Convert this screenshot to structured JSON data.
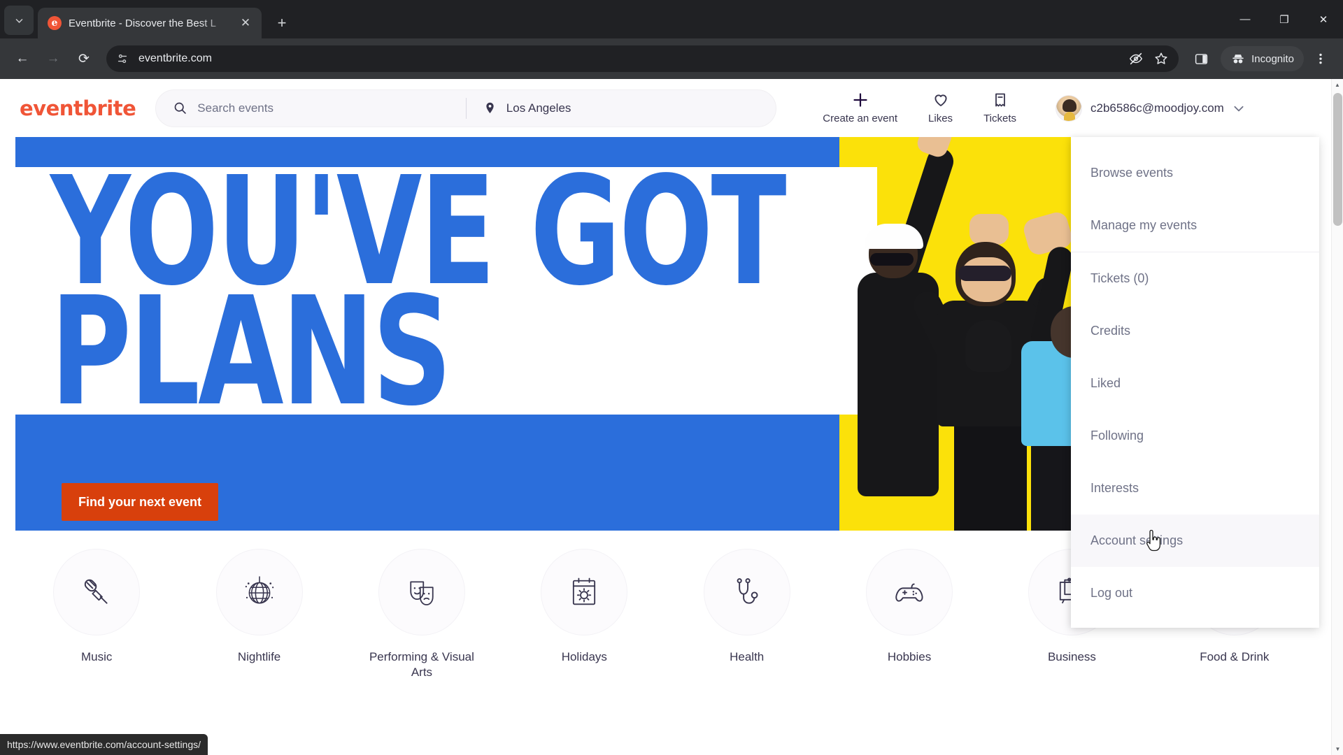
{
  "browser": {
    "tab": {
      "title": "Eventbrite - Discover the Best L",
      "favicon_letter": "e",
      "close_label": "✕",
      "search_tabs_icon": "chevron-down-icon"
    },
    "new_tab_label": "+",
    "window_controls": {
      "minimize": "—",
      "maximize": "❐",
      "close": "✕"
    },
    "nav": {
      "back": "←",
      "forward": "→",
      "reload": "⟳"
    },
    "omnibox": {
      "url": "eventbrite.com",
      "site_info_icon": "tune-icon"
    },
    "toolbar_right": {
      "hide_icon": "eye-slash-icon",
      "bookmark_icon": "star-icon",
      "sidepanel_icon": "side-panel-icon",
      "incognito_label": "Incognito",
      "menu_icon": "kebab-menu-icon"
    }
  },
  "status_bar": {
    "url": "https://www.eventbrite.com/account-settings/"
  },
  "site": {
    "logo": "eventbrite",
    "search": {
      "events_placeholder": "Search events",
      "location_value": "Los Angeles",
      "search_icon": "magnifier-icon",
      "location_icon": "map-pin-icon"
    },
    "nav": [
      {
        "label": "Create an event",
        "icon": "plus-icon"
      },
      {
        "label": "Likes",
        "icon": "heart-icon"
      },
      {
        "label": "Tickets",
        "icon": "ticket-icon"
      }
    ],
    "account": {
      "email": "c2b6586c@moodjoy.com",
      "avatar_icon": "user-avatar",
      "chevron_icon": "chevron-down-icon"
    },
    "dropdown": {
      "items": [
        {
          "label": "Browse events",
          "hover": false
        },
        {
          "label": "Manage my events",
          "hover": false
        },
        {
          "label": "Tickets (0)",
          "hover": false
        },
        {
          "label": "Credits",
          "hover": false
        },
        {
          "label": "Liked",
          "hover": false
        },
        {
          "label": "Following",
          "hover": false
        },
        {
          "label": "Interests",
          "hover": false
        },
        {
          "label": "Account settings",
          "hover": true
        },
        {
          "label": "Log out",
          "hover": false
        }
      ]
    },
    "hero": {
      "headline_line1": "YOU'VE GOT",
      "headline_line2": "PLANS",
      "cta_label": "Find your next event",
      "bg_blue": "#2b6edb",
      "bg_yellow": "#fbe10a",
      "cta_color": "#d8400c"
    },
    "categories": [
      {
        "label": "Music",
        "icon": "microphone-icon"
      },
      {
        "label": "Nightlife",
        "icon": "disco-ball-icon"
      },
      {
        "label": "Performing & Visual Arts",
        "icon": "theater-masks-icon"
      },
      {
        "label": "Holidays",
        "icon": "calendar-sun-icon"
      },
      {
        "label": "Health",
        "icon": "stethoscope-icon"
      },
      {
        "label": "Hobbies",
        "icon": "gamepad-icon"
      },
      {
        "label": "Business",
        "icon": "presentation-board-icon"
      },
      {
        "label": "Food & Drink",
        "icon": "pizza-icon"
      }
    ]
  }
}
